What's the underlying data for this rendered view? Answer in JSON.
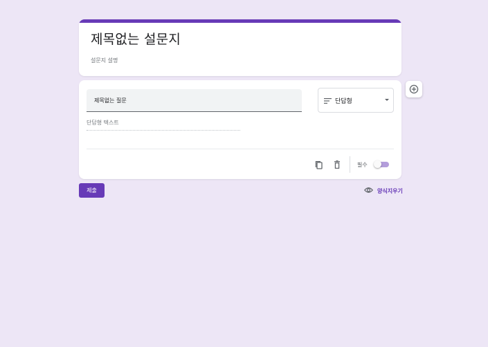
{
  "form": {
    "title": "제목없는 설문지",
    "description": "설문지 설명"
  },
  "question": {
    "title": "제목없는 질문",
    "type_label": "단답형",
    "type_icon": "short-text-icon",
    "answer_placeholder": "단답형 텍스트",
    "required_label": "필수",
    "required": false
  },
  "footer": {
    "submit_label": "제출",
    "clear_label": "양식지우기",
    "preview_icon": "eye-icon"
  },
  "colors": {
    "accent": "#673ab7",
    "background": "#ede6f6",
    "toggle_track": "#b39ddb"
  }
}
